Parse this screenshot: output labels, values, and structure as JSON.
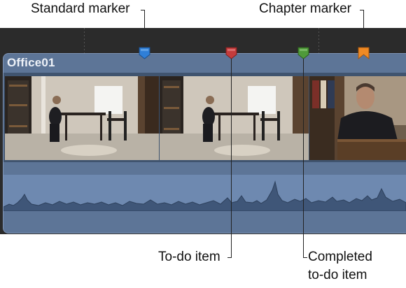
{
  "callouts": {
    "standard_marker": "Standard marker",
    "chapter_marker": "Chapter marker",
    "todo_item": "To-do item",
    "completed_todo_line1": "Completed",
    "completed_todo_line2": "to-do item"
  },
  "clip": {
    "name": "Office01"
  },
  "markers": [
    {
      "kind": "standard",
      "icon": "standard-marker-icon",
      "color": "#2f7fd8"
    },
    {
      "kind": "to-do",
      "icon": "todo-marker-icon",
      "color": "#c43c3c"
    },
    {
      "kind": "completed-to-do",
      "icon": "completed-todo-marker-icon",
      "color": "#4f9a3a"
    },
    {
      "kind": "chapter",
      "icon": "chapter-marker-icon",
      "color": "#f08a24"
    }
  ],
  "colors": {
    "timeline_bg": "#2b2b2b",
    "clip_body": "#5d7597",
    "audio_waveform": "#6e89b0"
  }
}
